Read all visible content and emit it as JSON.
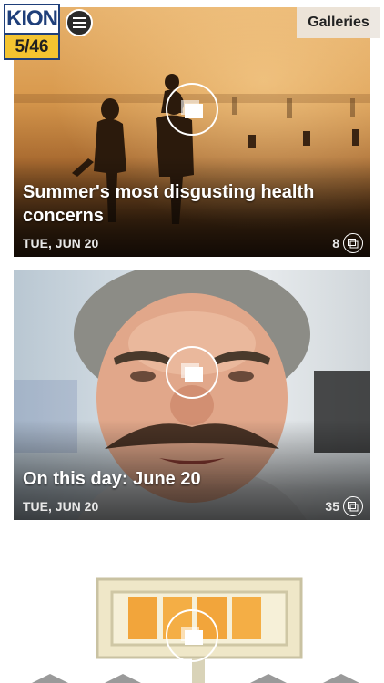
{
  "header": {
    "logo_top": "KION",
    "logo_bottom": "5/46",
    "menu_icon": "hamburger-menu-icon",
    "galleries_label": "Galleries"
  },
  "colors": {
    "logo_blue": "#1f3f7a",
    "logo_yellow": "#f4c430"
  },
  "galleries": [
    {
      "title": "Summer's most disgusting health concerns",
      "date": "TUE, JUN 20",
      "count": "8",
      "icon": "gallery-stack-icon"
    },
    {
      "title": "On this day: June 20",
      "date": "TUE, JUN 20",
      "count": "35",
      "icon": "gallery-stack-icon"
    },
    {
      "title": "",
      "date": "",
      "count": "",
      "icon": "gallery-stack-icon"
    }
  ]
}
